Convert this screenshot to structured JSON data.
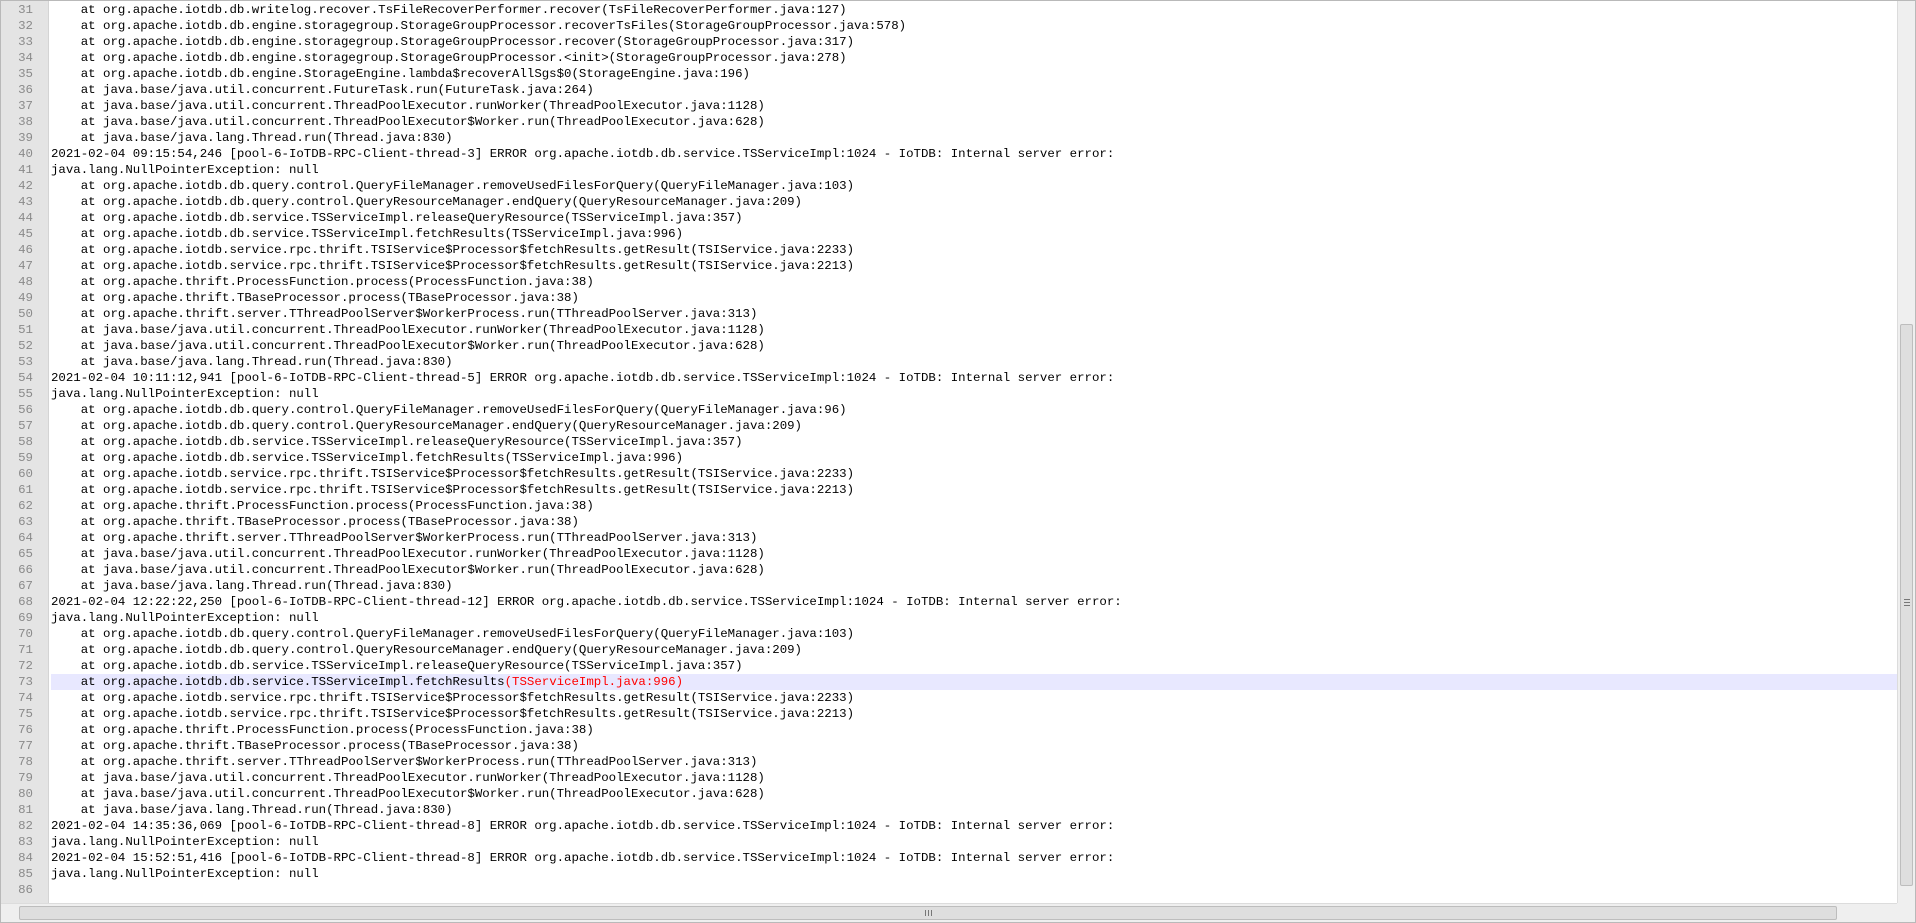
{
  "editor": {
    "current_line": 73,
    "lines": [
      {
        "n": "31",
        "text": "    at org.apache.iotdb.db.writelog.recover.TsFileRecoverPerformer.recover(TsFileRecoverPerformer.java:127)"
      },
      {
        "n": "32",
        "text": "    at org.apache.iotdb.db.engine.storagegroup.StorageGroupProcessor.recoverTsFiles(StorageGroupProcessor.java:578)"
      },
      {
        "n": "33",
        "text": "    at org.apache.iotdb.db.engine.storagegroup.StorageGroupProcessor.recover(StorageGroupProcessor.java:317)"
      },
      {
        "n": "34",
        "text": "    at org.apache.iotdb.db.engine.storagegroup.StorageGroupProcessor.<init>(StorageGroupProcessor.java:278)"
      },
      {
        "n": "35",
        "text": "    at org.apache.iotdb.db.engine.StorageEngine.lambda$recoverAllSgs$0(StorageEngine.java:196)"
      },
      {
        "n": "36",
        "text": "    at java.base/java.util.concurrent.FutureTask.run(FutureTask.java:264)"
      },
      {
        "n": "37",
        "text": "    at java.base/java.util.concurrent.ThreadPoolExecutor.runWorker(ThreadPoolExecutor.java:1128)"
      },
      {
        "n": "38",
        "text": "    at java.base/java.util.concurrent.ThreadPoolExecutor$Worker.run(ThreadPoolExecutor.java:628)"
      },
      {
        "n": "39",
        "text": "    at java.base/java.lang.Thread.run(Thread.java:830)"
      },
      {
        "n": "40",
        "text": "2021-02-04 09:15:54,246 [pool-6-IoTDB-RPC-Client-thread-3] ERROR org.apache.iotdb.db.service.TSServiceImpl:1024 - IoTDB: Internal server error: "
      },
      {
        "n": "41",
        "text": "java.lang.NullPointerException: null"
      },
      {
        "n": "42",
        "text": "    at org.apache.iotdb.db.query.control.QueryFileManager.removeUsedFilesForQuery(QueryFileManager.java:103)"
      },
      {
        "n": "43",
        "text": "    at org.apache.iotdb.db.query.control.QueryResourceManager.endQuery(QueryResourceManager.java:209)"
      },
      {
        "n": "44",
        "text": "    at org.apache.iotdb.db.service.TSServiceImpl.releaseQueryResource(TSServiceImpl.java:357)"
      },
      {
        "n": "45",
        "text": "    at org.apache.iotdb.db.service.TSServiceImpl.fetchResults(TSServiceImpl.java:996)"
      },
      {
        "n": "46",
        "text": "    at org.apache.iotdb.service.rpc.thrift.TSIService$Processor$fetchResults.getResult(TSIService.java:2233)"
      },
      {
        "n": "47",
        "text": "    at org.apache.iotdb.service.rpc.thrift.TSIService$Processor$fetchResults.getResult(TSIService.java:2213)"
      },
      {
        "n": "48",
        "text": "    at org.apache.thrift.ProcessFunction.process(ProcessFunction.java:38)"
      },
      {
        "n": "49",
        "text": "    at org.apache.thrift.TBaseProcessor.process(TBaseProcessor.java:38)"
      },
      {
        "n": "50",
        "text": "    at org.apache.thrift.server.TThreadPoolServer$WorkerProcess.run(TThreadPoolServer.java:313)"
      },
      {
        "n": "51",
        "text": "    at java.base/java.util.concurrent.ThreadPoolExecutor.runWorker(ThreadPoolExecutor.java:1128)"
      },
      {
        "n": "52",
        "text": "    at java.base/java.util.concurrent.ThreadPoolExecutor$Worker.run(ThreadPoolExecutor.java:628)"
      },
      {
        "n": "53",
        "text": "    at java.base/java.lang.Thread.run(Thread.java:830)"
      },
      {
        "n": "54",
        "text": "2021-02-04 10:11:12,941 [pool-6-IoTDB-RPC-Client-thread-5] ERROR org.apache.iotdb.db.service.TSServiceImpl:1024 - IoTDB: Internal server error: "
      },
      {
        "n": "55",
        "text": "java.lang.NullPointerException: null"
      },
      {
        "n": "56",
        "text": "    at org.apache.iotdb.db.query.control.QueryFileManager.removeUsedFilesForQuery(QueryFileManager.java:96)"
      },
      {
        "n": "57",
        "text": "    at org.apache.iotdb.db.query.control.QueryResourceManager.endQuery(QueryResourceManager.java:209)"
      },
      {
        "n": "58",
        "text": "    at org.apache.iotdb.db.service.TSServiceImpl.releaseQueryResource(TSServiceImpl.java:357)"
      },
      {
        "n": "59",
        "text": "    at org.apache.iotdb.db.service.TSServiceImpl.fetchResults(TSServiceImpl.java:996)"
      },
      {
        "n": "60",
        "text": "    at org.apache.iotdb.service.rpc.thrift.TSIService$Processor$fetchResults.getResult(TSIService.java:2233)"
      },
      {
        "n": "61",
        "text": "    at org.apache.iotdb.service.rpc.thrift.TSIService$Processor$fetchResults.getResult(TSIService.java:2213)"
      },
      {
        "n": "62",
        "text": "    at org.apache.thrift.ProcessFunction.process(ProcessFunction.java:38)"
      },
      {
        "n": "63",
        "text": "    at org.apache.thrift.TBaseProcessor.process(TBaseProcessor.java:38)"
      },
      {
        "n": "64",
        "text": "    at org.apache.thrift.server.TThreadPoolServer$WorkerProcess.run(TThreadPoolServer.java:313)"
      },
      {
        "n": "65",
        "text": "    at java.base/java.util.concurrent.ThreadPoolExecutor.runWorker(ThreadPoolExecutor.java:1128)"
      },
      {
        "n": "66",
        "text": "    at java.base/java.util.concurrent.ThreadPoolExecutor$Worker.run(ThreadPoolExecutor.java:628)"
      },
      {
        "n": "67",
        "text": "    at java.base/java.lang.Thread.run(Thread.java:830)"
      },
      {
        "n": "68",
        "text": "2021-02-04 12:22:22,250 [pool-6-IoTDB-RPC-Client-thread-12] ERROR org.apache.iotdb.db.service.TSServiceImpl:1024 - IoTDB: Internal server error: "
      },
      {
        "n": "69",
        "text": "java.lang.NullPointerException: null"
      },
      {
        "n": "70",
        "text": "    at org.apache.iotdb.db.query.control.QueryFileManager.removeUsedFilesForQuery(QueryFileManager.java:103)"
      },
      {
        "n": "71",
        "text": "    at org.apache.iotdb.db.query.control.QueryResourceManager.endQuery(QueryResourceManager.java:209)"
      },
      {
        "n": "72",
        "text": "    at org.apache.iotdb.db.service.TSServiceImpl.releaseQueryResource(TSServiceImpl.java:357)"
      },
      {
        "n": "73",
        "text": "    at org.apache.iotdb.db.service.TSServiceImpl.fetchResults",
        "hl": "(TSServiceImpl.java:996)"
      },
      {
        "n": "74",
        "text": "    at org.apache.iotdb.service.rpc.thrift.TSIService$Processor$fetchResults.getResult(TSIService.java:2233)"
      },
      {
        "n": "75",
        "text": "    at org.apache.iotdb.service.rpc.thrift.TSIService$Processor$fetchResults.getResult(TSIService.java:2213)"
      },
      {
        "n": "76",
        "text": "    at org.apache.thrift.ProcessFunction.process(ProcessFunction.java:38)"
      },
      {
        "n": "77",
        "text": "    at org.apache.thrift.TBaseProcessor.process(TBaseProcessor.java:38)"
      },
      {
        "n": "78",
        "text": "    at org.apache.thrift.server.TThreadPoolServer$WorkerProcess.run(TThreadPoolServer.java:313)"
      },
      {
        "n": "79",
        "text": "    at java.base/java.util.concurrent.ThreadPoolExecutor.runWorker(ThreadPoolExecutor.java:1128)"
      },
      {
        "n": "80",
        "text": "    at java.base/java.util.concurrent.ThreadPoolExecutor$Worker.run(ThreadPoolExecutor.java:628)"
      },
      {
        "n": "81",
        "text": "    at java.base/java.lang.Thread.run(Thread.java:830)"
      },
      {
        "n": "82",
        "text": "2021-02-04 14:35:36,069 [pool-6-IoTDB-RPC-Client-thread-8] ERROR org.apache.iotdb.db.service.TSServiceImpl:1024 - IoTDB: Internal server error: "
      },
      {
        "n": "83",
        "text": "java.lang.NullPointerException: null"
      },
      {
        "n": "84",
        "text": "2021-02-04 15:52:51,416 [pool-6-IoTDB-RPC-Client-thread-8] ERROR org.apache.iotdb.db.service.TSServiceImpl:1024 - IoTDB: Internal server error: "
      },
      {
        "n": "85",
        "text": "java.lang.NullPointerException: null"
      },
      {
        "n": "86",
        "text": ""
      }
    ]
  },
  "colors": {
    "gutter_bg": "#e4e4e4",
    "line_number": "#8a8a8a",
    "current_line_bg": "#e8e8ff",
    "brace_highlight": "#ff0000"
  },
  "icons": {
    "vertical_scroll_grip": "grip-horizontal-lines-icon",
    "horizontal_scroll_grip": "grip-vertical-lines-icon"
  }
}
